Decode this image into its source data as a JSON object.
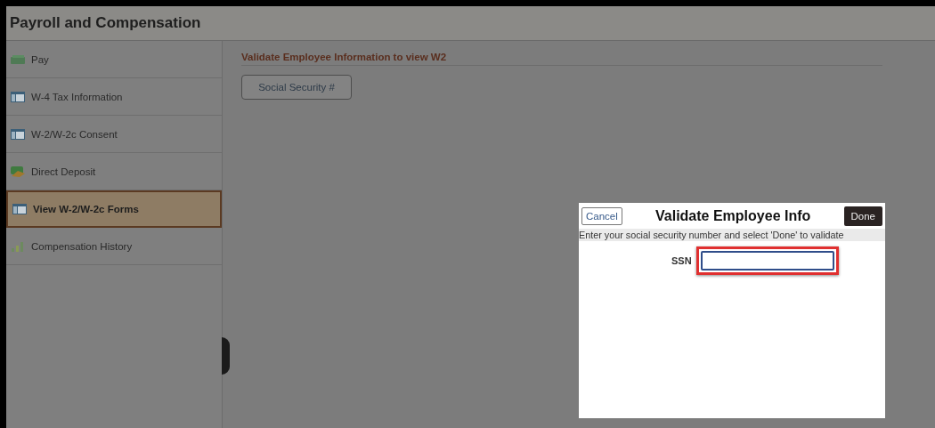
{
  "header": {
    "title": "Payroll and Compensation"
  },
  "sidebar": {
    "items": [
      {
        "label": "Pay",
        "kind": "money",
        "selected": false
      },
      {
        "label": "W-4 Tax Information",
        "kind": "form",
        "selected": false
      },
      {
        "label": "W-2/W-2c Consent",
        "kind": "form",
        "selected": false
      },
      {
        "label": "Direct Deposit",
        "kind": "deposit",
        "selected": false
      },
      {
        "label": "View W-2/W-2c Forms",
        "kind": "form",
        "selected": true
      },
      {
        "label": "Compensation History",
        "kind": "chart",
        "selected": false
      }
    ]
  },
  "main": {
    "heading": "Validate Employee Information to view W2",
    "button": "Social Security #"
  },
  "dialog": {
    "cancel": "Cancel",
    "title": "Validate Employee Info",
    "done": "Done",
    "instruction": "Enter your social security number and select 'Done' to validate",
    "field_label": "SSN",
    "highlighted": true
  }
}
